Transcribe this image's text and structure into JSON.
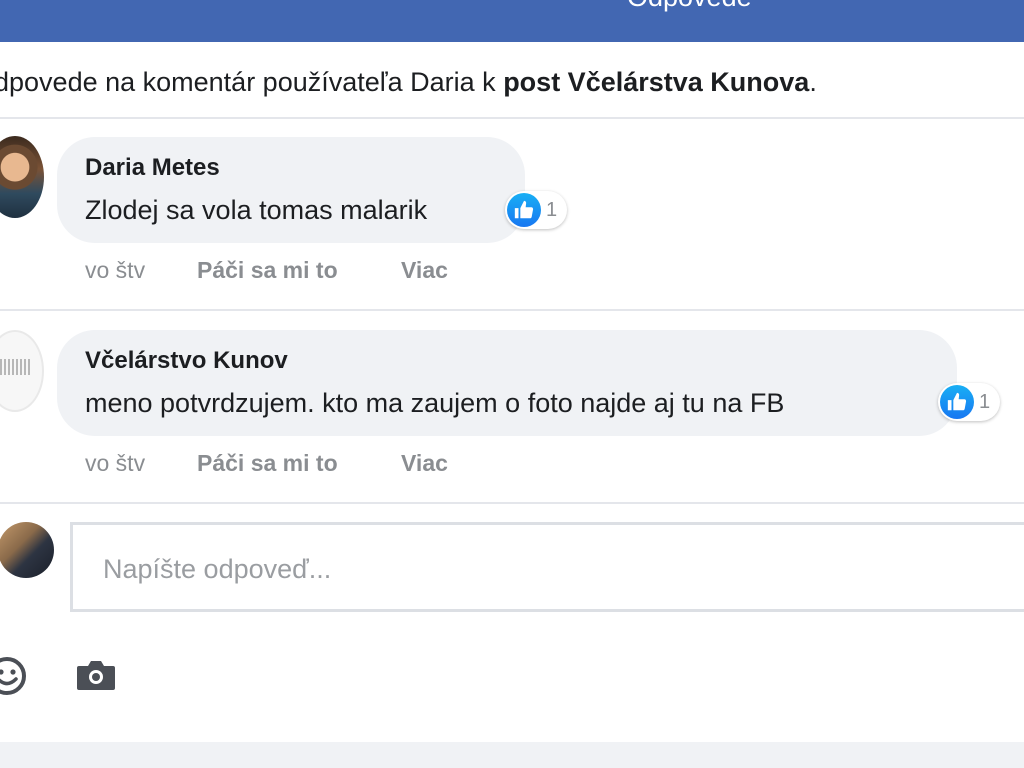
{
  "header": {
    "title": "Odpovede"
  },
  "context": {
    "prefix": "dpovede na komentár používateľa Daria k ",
    "link": "post Včelárstva Kunova",
    "suffix": "."
  },
  "comments": [
    {
      "author": "Daria Metes",
      "text": "Zlodej sa vola tomas malarik",
      "reaction_count": "1",
      "time": "vo štv",
      "like_label": "Páči sa mi to",
      "more_label": "Viac"
    },
    {
      "author": "Včelárstvo Kunov",
      "text": "meno potvrdzujem. kto ma zaujem o foto najde aj tu na FB",
      "reaction_count": "1",
      "time": "vo štv",
      "like_label": "Páči sa mi to",
      "more_label": "Viac"
    }
  ],
  "reply": {
    "placeholder": "Napíšte odpoveď..."
  },
  "icons": {
    "like": "thumbs-up-icon",
    "emoji": "smiley-icon",
    "camera": "camera-icon"
  },
  "colors": {
    "header_bg": "#4267b2",
    "bubble_bg": "#f0f2f5",
    "like_blue": "#1877f2",
    "meta_gray": "#8a8d91"
  }
}
